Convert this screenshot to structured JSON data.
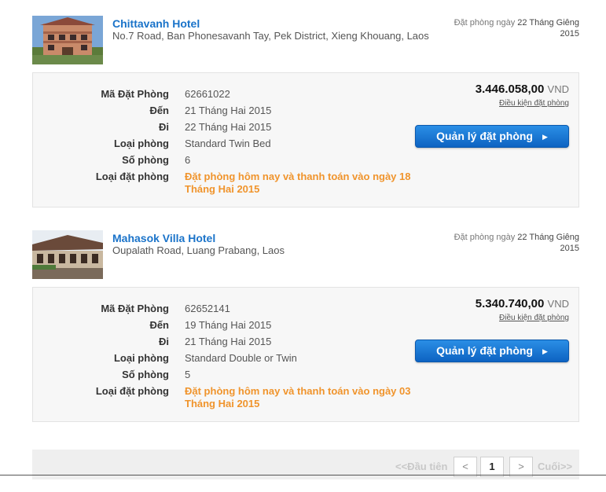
{
  "bookings": [
    {
      "hotel_name": "Chittavanh Hotel",
      "address": "No.7 Road, Ban Phonesavanh Tay, Pek District, Xieng Khouang, Laos",
      "booked_on_label": "Đặt phòng ngày",
      "booked_on_date": "22 Tháng Giêng 2015",
      "price": "3.446.058,00",
      "currency": "VND",
      "terms_label": "Điều kiện đặt phòng",
      "manage_label": "Quản lý đặt phòng",
      "fields": [
        {
          "label": "Mã Đặt Phòng",
          "value": "62661022"
        },
        {
          "label": "Đến",
          "value": "21 Tháng Hai 2015"
        },
        {
          "label": "Đi",
          "value": "22 Tháng Hai 2015"
        },
        {
          "label": "Loại phòng",
          "value": "Standard Twin Bed"
        },
        {
          "label": "Số phòng",
          "value": "6"
        },
        {
          "label": "Loại đặt phòng",
          "value": "Đặt phòng hôm nay và thanh toán vào ngày 18 Tháng Hai 2015"
        }
      ]
    },
    {
      "hotel_name": "Mahasok Villa Hotel",
      "address": "Oupalath Road, Luang Prabang, Laos",
      "booked_on_label": "Đặt phòng ngày",
      "booked_on_date": "22 Tháng Giêng 2015",
      "price": "5.340.740,00",
      "currency": "VND",
      "terms_label": "Điều kiện đặt phòng",
      "manage_label": "Quản lý đặt phòng",
      "fields": [
        {
          "label": "Mã Đặt Phòng",
          "value": "62652141"
        },
        {
          "label": "Đến",
          "value": "19 Tháng Hai 2015"
        },
        {
          "label": "Đi",
          "value": "21 Tháng Hai 2015"
        },
        {
          "label": "Loại phòng",
          "value": "Standard Double or Twin"
        },
        {
          "label": "Số phòng",
          "value": "5"
        },
        {
          "label": "Loại đặt phòng",
          "value": "Đặt phòng hôm nay và thanh toán vào ngày 03 Tháng Hai 2015"
        }
      ]
    }
  ],
  "pager": {
    "first": "<<Đầu tiên",
    "prev": "<",
    "current": "1",
    "next": ">",
    "last": "Cuối>>"
  },
  "colors": {
    "link": "#1a73c9",
    "warn": "#f0942c",
    "button": "#1474d4"
  }
}
